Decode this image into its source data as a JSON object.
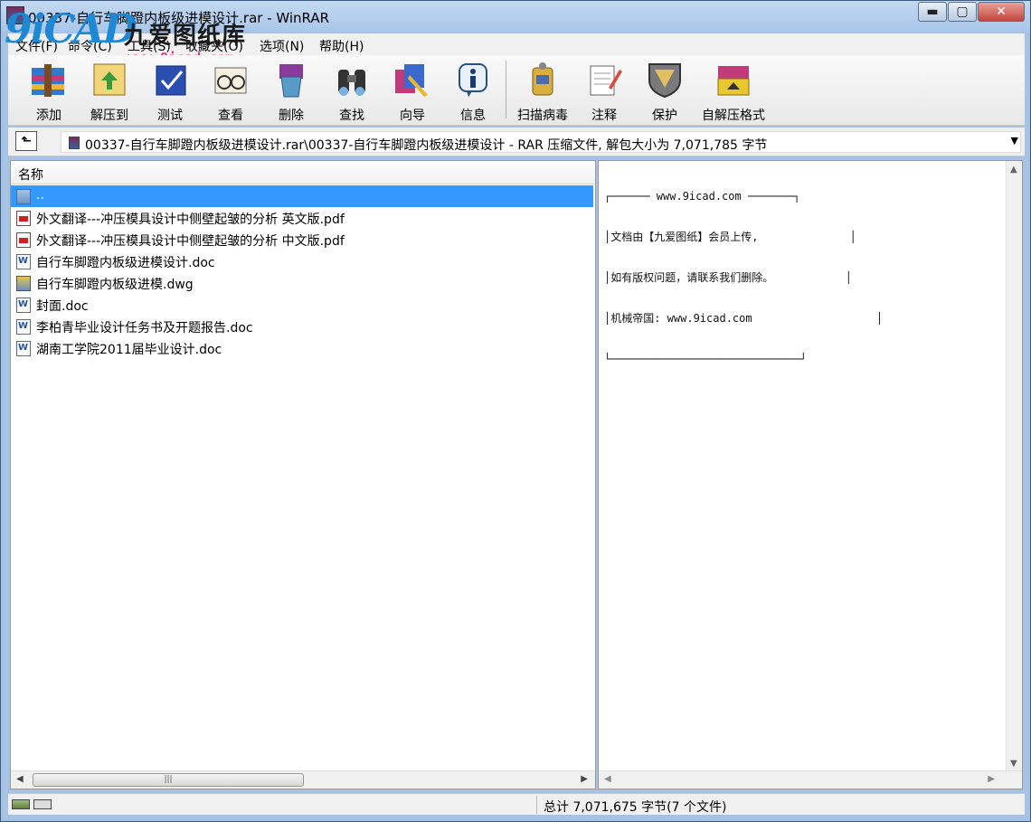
{
  "window": {
    "title": "00337-自行车脚蹬内板级进模设计.rar - WinRAR",
    "minimize": "▬",
    "maximize": "▢",
    "close": "✕"
  },
  "watermark": {
    "logo_text": "9iCAD",
    "cn_text": "九爱图纸库",
    "url": "www.9icad.com"
  },
  "menu": {
    "items": [
      {
        "label": "文件(F)"
      },
      {
        "label": "命令(C)"
      },
      {
        "label": "工具(S)"
      },
      {
        "label": "收藏夹(O)"
      },
      {
        "label": "选项(N)"
      },
      {
        "label": "帮助(H)"
      }
    ]
  },
  "toolbar": {
    "buttons": [
      {
        "label": "添加",
        "icon": "add-archive-icon"
      },
      {
        "label": "解压到",
        "icon": "extract-to-icon"
      },
      {
        "label": "测试",
        "icon": "test-icon"
      },
      {
        "label": "查看",
        "icon": "view-icon"
      },
      {
        "label": "删除",
        "icon": "delete-icon"
      },
      {
        "label": "查找",
        "icon": "find-icon"
      },
      {
        "label": "向导",
        "icon": "wizard-icon"
      },
      {
        "label": "信息",
        "icon": "info-icon"
      },
      {
        "label": "扫描病毒",
        "icon": "virus-scan-icon"
      },
      {
        "label": "注释",
        "icon": "comment-icon"
      },
      {
        "label": "保护",
        "icon": "protect-icon"
      },
      {
        "label": "自解压格式",
        "icon": "sfx-icon"
      }
    ]
  },
  "address": {
    "up_icon": "up-folder-icon",
    "path": "00337-自行车脚蹬内板级进模设计.rar\\00337-自行车脚蹬内板级进模设计 - RAR 压缩文件, 解包大小为 7,071,785 字节"
  },
  "filelist": {
    "column_name": "名称",
    "rows": [
      {
        "name": "..",
        "type": "folder",
        "selected": true
      },
      {
        "name": "外文翻译---冲压模具设计中侧壁起皱的分析  英文版.pdf",
        "type": "pdf"
      },
      {
        "name": "外文翻译---冲压模具设计中侧壁起皱的分析   中文版.pdf",
        "type": "pdf"
      },
      {
        "name": "自行车脚蹬内板级进模设计.doc",
        "type": "doc"
      },
      {
        "name": "自行车脚蹬内板级进模.dwg",
        "type": "dwg"
      },
      {
        "name": "封面.doc",
        "type": "doc"
      },
      {
        "name": "李柏青毕业设计任务书及开题报告.doc",
        "type": "doc"
      },
      {
        "name": "湖南工学院2011届毕业设计.doc",
        "type": "doc"
      }
    ]
  },
  "comment": {
    "lines": [
      "┌────── www.9icad.com ───────┐",
      "│文档由【九爱图纸】会员上传,              │",
      "│如有版权问题，请联系我们删除。           │",
      "│机械帝国: www.9icad.com                   │",
      "└─────────────────────────────┘"
    ]
  },
  "status": {
    "total": "总计 7,071,675 字节(7 个文件)"
  }
}
